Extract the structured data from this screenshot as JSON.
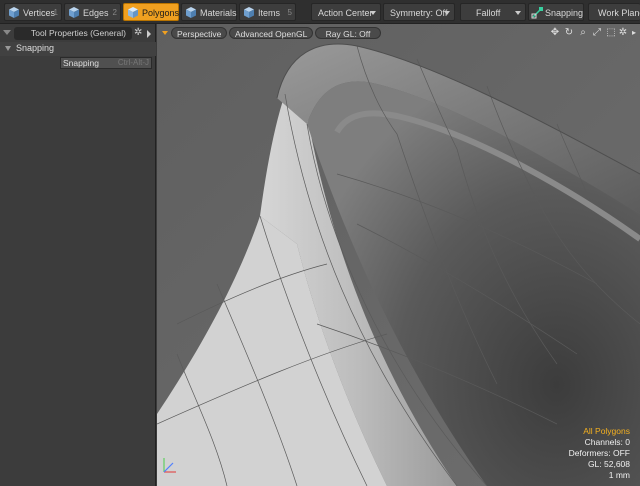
{
  "toolbar": {
    "modes": [
      {
        "label": "Vertices",
        "key": "1",
        "active": false
      },
      {
        "label": "Edges",
        "key": "2",
        "active": false
      },
      {
        "label": "Polygons",
        "key": "",
        "active": true
      },
      {
        "label": "Materials",
        "key": "",
        "active": false
      },
      {
        "label": "Items",
        "key": "5",
        "active": false
      }
    ],
    "action_center": "Action Center",
    "symmetry": "Symmetry: Off",
    "falloff": "Falloff",
    "snapping": "Snapping",
    "work_plane": "Work Plane"
  },
  "left_panel": {
    "title": "Tool Properties (General)",
    "section": "Snapping",
    "row_label": "Snapping",
    "row_shortcut": "Ctrl-Alt-J"
  },
  "viewport": {
    "view": "Perspective",
    "render_mode": "Advanced OpenGL",
    "raygl": "Ray GL: Off",
    "info": {
      "selection": "All Polygons",
      "channels": "Channels: 0",
      "deformers": "Deformers: OFF",
      "gl": "GL: 52,608",
      "scale": "1 mm"
    }
  },
  "colors": {
    "accent": "#f0a020",
    "toolbar_bg": "#2f2f2f",
    "panel_bg": "#3c3c3c"
  },
  "icons": {
    "mode_icon": "cube-icon",
    "snapping_icon": "snap-magnet-icon",
    "viewport_tools": [
      "move-view-icon",
      "rotate-view-icon",
      "zoom-view-icon",
      "fit-view-icon",
      "maximize-icon",
      "more-arrow-icon"
    ],
    "settings": "gear-icon"
  }
}
